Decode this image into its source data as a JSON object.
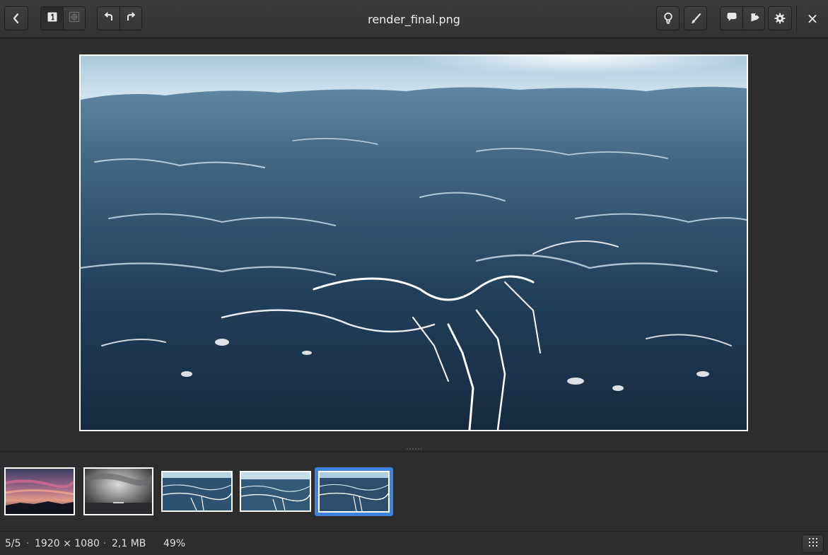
{
  "header": {
    "title": "render_final.png",
    "back_icon": "back-arrow-icon",
    "view_single_icon": "single-page-icon",
    "view_grid_icon": "fit-grid-icon",
    "rotate_left_icon": "rotate-left-icon",
    "rotate_right_icon": "rotate-right-icon",
    "bulb_icon": "lightbulb-icon",
    "brush_icon": "paintbrush-icon",
    "comment_icon": "comment-icon",
    "tag_icon": "tag-icon",
    "settings_icon": "gear-icon",
    "close_label": "×"
  },
  "viewer": {
    "image_subject": "ocean"
  },
  "thumbnails": [
    {
      "subject": "sunset"
    },
    {
      "subject": "cloudy-sea"
    },
    {
      "subject": "ocean"
    },
    {
      "subject": "ocean"
    },
    {
      "subject": "ocean",
      "selected": true
    }
  ],
  "status": {
    "position": "5/5",
    "dimensions": "1920 × 1080",
    "file_size": "2,1 MB",
    "zoom": "49%",
    "separator": "·"
  },
  "colors": {
    "accent": "#3d82dd",
    "background": "#2d2d2d"
  }
}
